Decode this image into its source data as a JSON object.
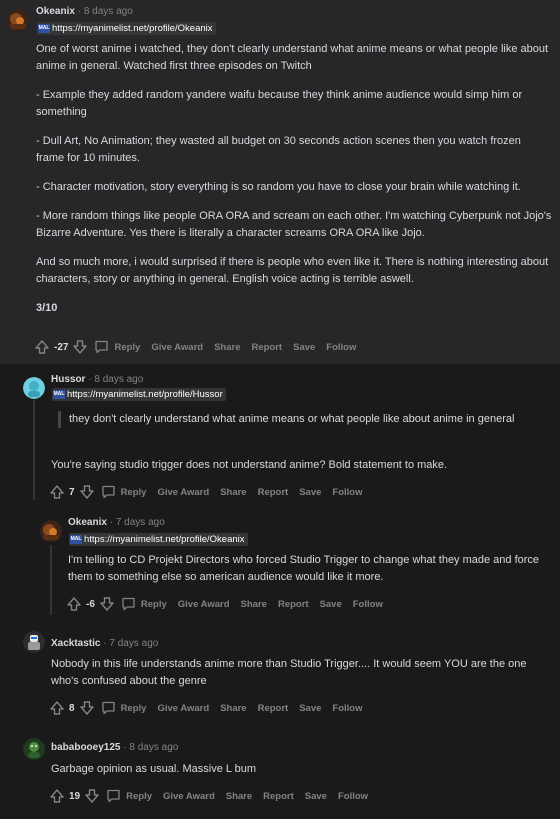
{
  "comments": [
    {
      "author": "Okeanix",
      "separator": "·",
      "time": "8 days ago",
      "flair": "https://myanimelist.net/profile/Okeanix",
      "paragraphs": [
        "One of worst anime i watched, they don't clearly understand what anime means or what people like about anime in general. Watched first three episodes on Twitch",
        "- Example they added random yandere waifu because they think anime audience would simp him or something",
        "- Dull Art, No Animation; they wasted all budget on 30 seconds action scenes then you watch frozen frame for 10 minutes.",
        "- Character motivation, story everything is so random you have to close your brain while watching it.",
        "- More random things like people ORA ORA and scream on each other. I'm watching Cyberpunk not Jojo's Bizarre Adventure. Yes there is literally a character screams ORA ORA like Jojo.",
        "And so much more, i would surprised if there is people who even like it. There is nothing interesting about characters, story or anything in general. English voice acting is terrible aswell.",
        "3/10"
      ],
      "score": "-27"
    },
    {
      "author": "Hussor",
      "separator": "·",
      "time": "8 days ago",
      "flair": "https://myanimelist.net/profile/Hussor",
      "quote": "they don't clearly understand what anime means or what people like about anime in general",
      "text": "You're saying studio trigger does not understand anime? Bold statement to make.",
      "score": "7"
    },
    {
      "author": "Okeanix",
      "separator": "·",
      "time": "7 days ago",
      "flair": "https://myanimelist.net/profile/Okeanix",
      "text": "I'm telling to CD Projekt Directors who forced Studio Trigger to change what they made and force them to something else so american audience would like it more.",
      "score": "-6"
    },
    {
      "author": "Xacktastic",
      "separator": "·",
      "time": "7 days ago",
      "text": "Nobody in this life understands anime more than Studio Trigger.... It would seem YOU are the one who's confused about the genre",
      "score": "8"
    },
    {
      "author": "bababooey125",
      "separator": "·",
      "time": "8 days ago",
      "text": "Garbage opinion as usual. Massive L bum",
      "score": "19"
    }
  ],
  "actions": {
    "reply": "Reply",
    "give_award": "Give Award",
    "share": "Share",
    "report": "Report",
    "save": "Save",
    "follow": "Follow"
  },
  "flair_badge": "MAL",
  "colors": {
    "background": "#1a1a1b",
    "highlight_background": "#272729",
    "text": "#d7dadc",
    "meta": "#818384",
    "mal_blue": "#2e51a2"
  }
}
